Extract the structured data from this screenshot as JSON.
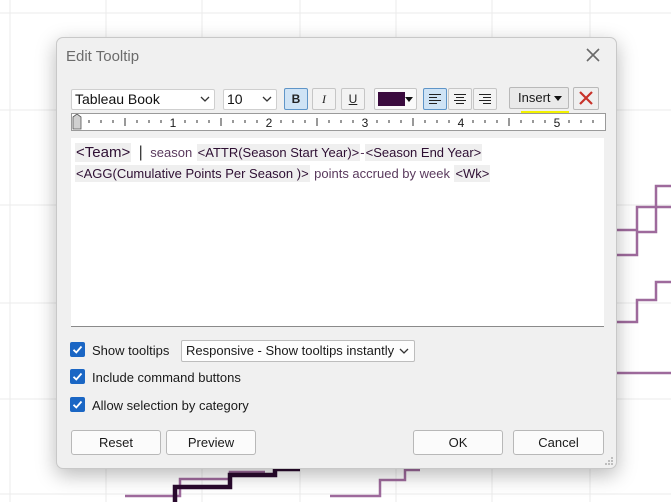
{
  "dialog": {
    "title": "Edit Tooltip",
    "close_icon": "close-icon"
  },
  "toolbar": {
    "font_family": "Tableau Book",
    "font_size": "10",
    "bold_label": "B",
    "italic_label": "I",
    "underline_label": "U",
    "text_color": "#3a0b3e",
    "insert_label": "Insert",
    "clear_icon": "red-x-icon"
  },
  "ruler": {
    "marks": [
      "1",
      "2",
      "3",
      "4",
      "5"
    ]
  },
  "editor": {
    "line1": {
      "team": "<Team>",
      "separator": "|",
      "season_text": "season",
      "start_year": "<ATTR(Season Start Year)>",
      "dash": "-",
      "end_year": "<Season End Year>"
    },
    "line2": {
      "points": "<AGG(Cumulative Points Per Season )>",
      "accrued_text": "points accrued by week",
      "week": "<Wk>"
    }
  },
  "options": {
    "show_tooltips": {
      "label": "Show tooltips",
      "checked": true
    },
    "tooltip_mode": "Responsive - Show tooltips instantly",
    "include_command_buttons": {
      "label": "Include command buttons",
      "checked": true
    },
    "allow_selection": {
      "label": "Allow selection by category",
      "checked": true
    }
  },
  "buttons": {
    "reset": "Reset",
    "preview": "Preview",
    "ok": "OK",
    "cancel": "Cancel"
  },
  "colors": {
    "accent": "#1a66c4",
    "line_series": "#9e6a9c",
    "highlight": "#f2f200"
  }
}
